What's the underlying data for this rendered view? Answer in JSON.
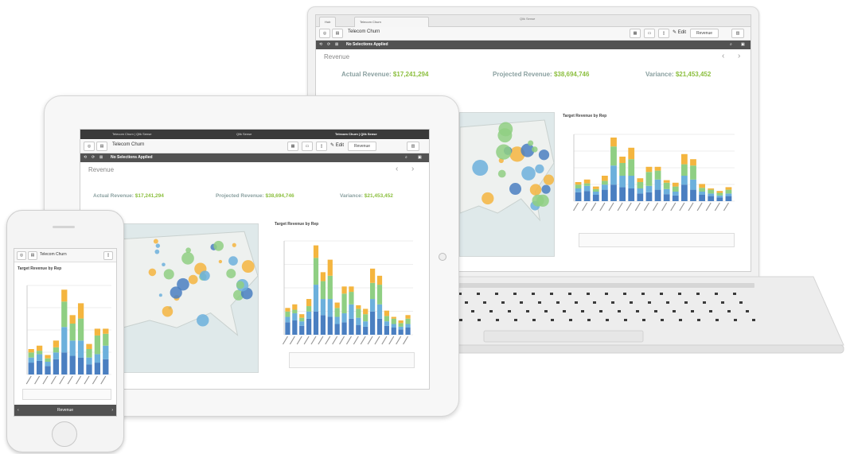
{
  "laptop": {
    "window_title": "Qlik Sense",
    "tabs": [
      "Hub",
      "Telecom Churn"
    ],
    "app_title": "Telecom Churn",
    "toolbar_edit": "Edit",
    "toolbar_sheet": "Revenue",
    "selections": "No Selections Applied",
    "sheet_title": "Revenue",
    "kpis": {
      "actual_label": "Actual Revenue:",
      "actual_value": "$17,241,294",
      "projected_label": "Projected Revenue:",
      "projected_value": "$38,694,746",
      "variance_label": "Variance:",
      "variance_value": "$21,453,452"
    },
    "chart_title": "Target Revenue by Rep"
  },
  "tablet": {
    "tabs": [
      "Telecom Churn | Qlik Sense",
      "Qlik Sense",
      "Telecom Churn | Qlik Sense"
    ],
    "app_title": "Telecom Churn",
    "toolbar_edit": "Edit",
    "toolbar_sheet": "Revenue",
    "selections": "No Selections Applied",
    "sheet_title": "Revenue",
    "kpis": {
      "actual_label": "Actual Revenue:",
      "actual_value": "$17,241,294",
      "projected_label": "Projected Revenue:",
      "projected_value": "$38,694,746",
      "variance_label": "Variance:",
      "variance_value": "$21,453,452"
    },
    "chart_title": "Target Revenue by Rep"
  },
  "phone": {
    "app_title": "Telecom Churn",
    "chart_title": "Target Revenue by Rep",
    "bottom_label": "Revenue"
  },
  "colors": {
    "blue": "#4a7fc1",
    "light_blue": "#6cb0dc",
    "green": "#8fcf83",
    "orange": "#f4b53f",
    "kpi_green": "#8cbf3f"
  },
  "chart_data": {
    "type": "bar",
    "stacked": true,
    "series": [
      {
        "values": [
          14,
          16,
          10,
          18,
          26,
          22,
          20,
          12,
          14,
          18,
          11,
          9,
          26,
          18,
          10,
          8,
          6,
          8
        ]
      },
      {
        "values": [
          6,
          8,
          5,
          8,
          30,
          18,
          20,
          8,
          10,
          16,
          8,
          6,
          14,
          16,
          5,
          4,
          3,
          4
        ]
      },
      {
        "values": [
          6,
          4,
          4,
          6,
          30,
          20,
          26,
          10,
          22,
          14,
          10,
          8,
          18,
          22,
          6,
          6,
          4,
          6
        ]
      },
      {
        "values": [
          4,
          6,
          4,
          8,
          14,
          10,
          18,
          6,
          8,
          6,
          4,
          6,
          16,
          10,
          6,
          2,
          3,
          4
        ]
      }
    ]
  }
}
